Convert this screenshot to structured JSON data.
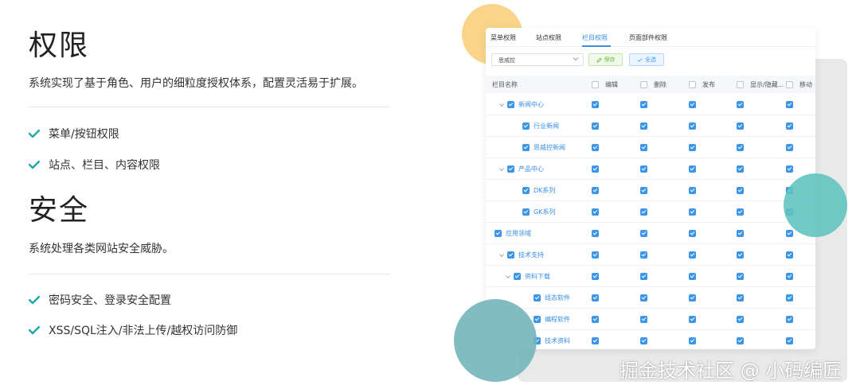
{
  "permissions": {
    "title": "权限",
    "description": "系统实现了基于角色、用户的细粒度授权体系，配置灵活易于扩展。",
    "features": [
      "菜单/按钮权限",
      "站点、栏目、内容权限"
    ]
  },
  "security": {
    "title": "安全",
    "description": "系统处理各类网站安全威胁。",
    "features": [
      "密码安全、登录安全配置",
      "XSS/SQL注入/非法上传/越权访问防御"
    ]
  },
  "colors": {
    "check": "#20a8a8",
    "accent": "#3a8ee6",
    "blob_yellow": "#f9d48a",
    "blob_teal": "#5fc3bf",
    "blob_teal_dark": "#6fb3b7"
  },
  "screenshot": {
    "tabs": [
      "菜单权限",
      "站点权限",
      "栏目权限",
      "页面部件权限"
    ],
    "active_tab": 2,
    "site_select": "思威控",
    "save_button": "保存",
    "select_all_button": "全选",
    "columns": [
      "栏目名称",
      "编辑",
      "删除",
      "发布",
      "显示/隐藏...",
      "移动"
    ],
    "rows": [
      {
        "label": "新闻中心",
        "level": 0,
        "expand": "down",
        "checked": true
      },
      {
        "label": "行业新闻",
        "level": 1,
        "expand": "none",
        "checked": true
      },
      {
        "label": "思威控新闻",
        "level": 1,
        "expand": "none",
        "checked": true
      },
      {
        "label": "产品中心",
        "level": 0,
        "expand": "down",
        "checked": true
      },
      {
        "label": "DK系列",
        "level": 1,
        "expand": "none",
        "checked": true
      },
      {
        "label": "GK系列",
        "level": 1,
        "expand": "none",
        "checked": true
      },
      {
        "label": "应用领域",
        "level": 0,
        "expand": "none",
        "checked": true
      },
      {
        "label": "技术支持",
        "level": 0,
        "expand": "down",
        "checked": true
      },
      {
        "label": "资料下载",
        "level": 1,
        "expand": "down",
        "checked": true
      },
      {
        "label": "组态软件",
        "level": 2,
        "expand": "none",
        "checked": true
      },
      {
        "label": "编程软件",
        "level": 2,
        "expand": "none",
        "checked": true
      },
      {
        "label": "技术资料",
        "level": 2,
        "expand": "none",
        "checked": true
      }
    ]
  },
  "watermark": "掘金技术社区 @ 小码编匠"
}
